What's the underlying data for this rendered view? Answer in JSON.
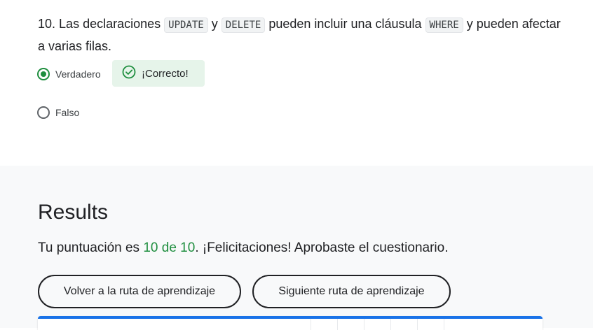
{
  "question": {
    "number": "10.",
    "text_1": "Las declaraciones",
    "code_1": "UPDATE",
    "text_2": "y",
    "code_2": "DELETE",
    "text_3": "pueden incluir una cláusula",
    "code_3": "WHERE",
    "text_4": "y pueden afectar a varias filas.",
    "options": [
      {
        "label": "Verdadero",
        "selected": true
      },
      {
        "label": "Falso",
        "selected": false
      }
    ],
    "feedback": "¡Correcto!"
  },
  "results": {
    "title": "Results",
    "score_prefix": "Tu puntuación es",
    "score": "10 de 10",
    "score_suffix": ". ¡Felicitaciones! Aprobaste el cuestionario.",
    "buttons": {
      "back": "Volver a la ruta de aprendizaje",
      "next": "Siguiente ruta de aprendizaje"
    }
  },
  "colors": {
    "success": "#1e8e3e",
    "success_bg": "#e6f4ea",
    "accent": "#1a73e8",
    "section_bg": "#f8f9fa"
  }
}
